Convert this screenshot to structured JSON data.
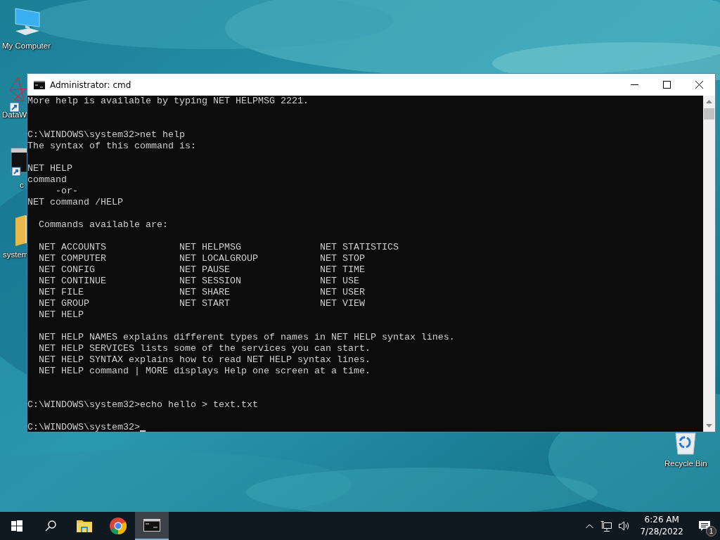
{
  "desktop": {
    "icons": [
      {
        "kind": "computer",
        "label": "My Computer"
      },
      {
        "kind": "network-art",
        "label": "DataW"
      },
      {
        "kind": "console",
        "label": "c"
      },
      {
        "kind": "folder",
        "label": "system"
      },
      {
        "kind": "recycle",
        "label": "Recycle Bin"
      }
    ]
  },
  "window": {
    "title": "Administrator: cmd",
    "console": {
      "lines": [
        {
          "kind": "text",
          "text": "More help is available by typing NET HELPMSG 2221."
        },
        {
          "kind": "blank"
        },
        {
          "kind": "blank"
        },
        {
          "kind": "text",
          "text": "C:\\WINDOWS\\system32>net help"
        },
        {
          "kind": "text",
          "text": "The syntax of this command is:"
        },
        {
          "kind": "blank"
        },
        {
          "kind": "text",
          "text": "NET HELP"
        },
        {
          "kind": "text",
          "text": "command"
        },
        {
          "kind": "text",
          "text": "     -or-"
        },
        {
          "kind": "text",
          "text": "NET command /HELP"
        },
        {
          "kind": "blank"
        },
        {
          "kind": "text",
          "text": "  Commands available are:"
        },
        {
          "kind": "blank"
        },
        {
          "kind": "columns",
          "cells": [
            "NET ACCOUNTS",
            "NET HELPMSG",
            "NET STATISTICS"
          ]
        },
        {
          "kind": "columns",
          "cells": [
            "NET COMPUTER",
            "NET LOCALGROUP",
            "NET STOP"
          ]
        },
        {
          "kind": "columns",
          "cells": [
            "NET CONFIG",
            "NET PAUSE",
            "NET TIME"
          ]
        },
        {
          "kind": "columns",
          "cells": [
            "NET CONTINUE",
            "NET SESSION",
            "NET USE"
          ]
        },
        {
          "kind": "columns",
          "cells": [
            "NET FILE",
            "NET SHARE",
            "NET USER"
          ]
        },
        {
          "kind": "columns",
          "cells": [
            "NET GROUP",
            "NET START",
            "NET VIEW"
          ]
        },
        {
          "kind": "columns",
          "cells": [
            "NET HELP"
          ]
        },
        {
          "kind": "blank"
        },
        {
          "kind": "text",
          "text": "  NET HELP NAMES explains different types of names in NET HELP syntax lines."
        },
        {
          "kind": "text",
          "text": "  NET HELP SERVICES lists some of the services you can start."
        },
        {
          "kind": "text",
          "text": "  NET HELP SYNTAX explains how to read NET HELP syntax lines."
        },
        {
          "kind": "text",
          "text": "  NET HELP command | MORE displays Help one screen at a time."
        },
        {
          "kind": "blank"
        },
        {
          "kind": "blank"
        },
        {
          "kind": "text",
          "text": "C:\\WINDOWS\\system32>echo hello > text.txt"
        },
        {
          "kind": "blank"
        },
        {
          "kind": "prompt",
          "text": "C:\\WINDOWS\\system32>"
        }
      ]
    }
  },
  "taskbar": {
    "items": [
      {
        "kind": "start",
        "selected": false
      },
      {
        "kind": "search",
        "selected": false
      },
      {
        "kind": "explorer",
        "selected": false
      },
      {
        "kind": "chrome",
        "selected": false
      },
      {
        "kind": "console",
        "selected": true
      }
    ],
    "tray": {
      "time": "6:26 AM",
      "date": "7/28/2022",
      "notification_count": "1"
    }
  }
}
